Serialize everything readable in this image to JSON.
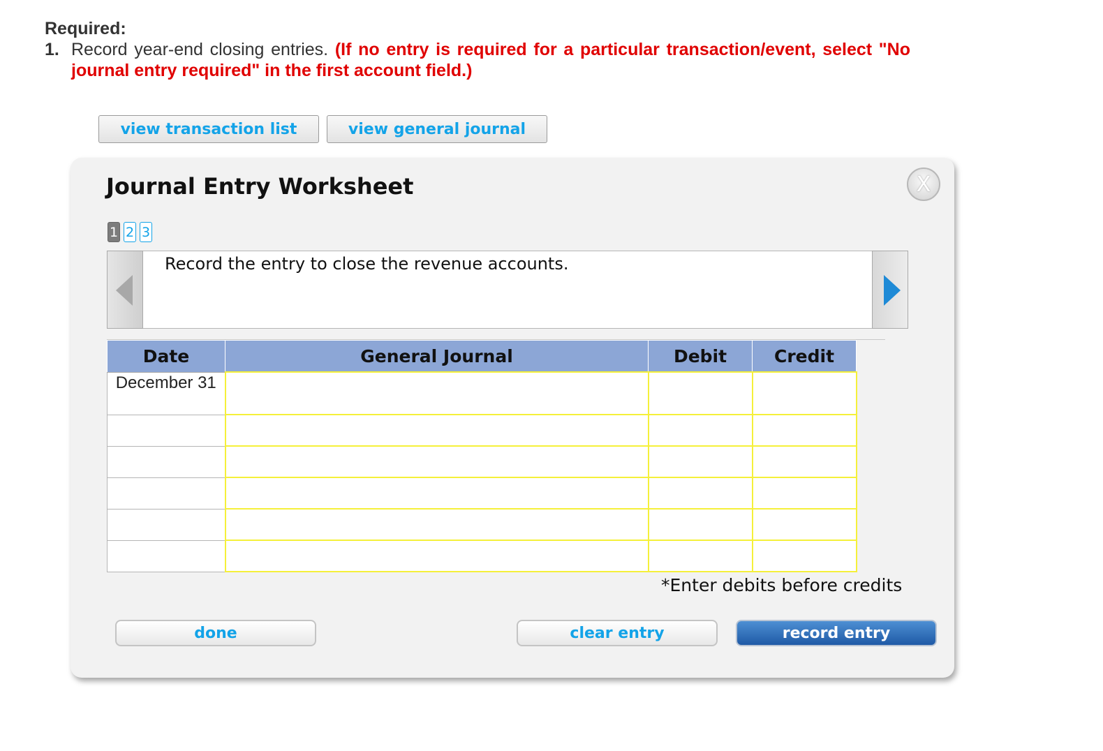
{
  "required": {
    "title": "Required:",
    "item_number": "1.",
    "item_text": "Record year-end closing entries.",
    "item_note": "(If no entry is required for a particular transaction/event, select \"No journal entry required\" in the first account field.)"
  },
  "top_buttons": {
    "transaction_list": "view transaction list",
    "general_journal": "view general journal"
  },
  "worksheet": {
    "title": "Journal Entry Worksheet",
    "close_label": "X",
    "steps": [
      "1",
      "2",
      "3"
    ],
    "active_step": 1,
    "instruction": "Record the entry to close the revenue accounts.",
    "columns": {
      "date": "Date",
      "general_journal": "General Journal",
      "debit": "Debit",
      "credit": "Credit"
    },
    "rows": [
      {
        "date": "December 31",
        "account": "",
        "debit": "",
        "credit": ""
      },
      {
        "date": "",
        "account": "",
        "debit": "",
        "credit": ""
      },
      {
        "date": "",
        "account": "",
        "debit": "",
        "credit": ""
      },
      {
        "date": "",
        "account": "",
        "debit": "",
        "credit": ""
      },
      {
        "date": "",
        "account": "",
        "debit": "",
        "credit": ""
      },
      {
        "date": "",
        "account": "",
        "debit": "",
        "credit": ""
      }
    ],
    "footnote": "*Enter debits before credits",
    "buttons": {
      "done": "done",
      "clear": "clear entry",
      "record": "record entry"
    }
  },
  "colors": {
    "link_blue": "#13a3e8",
    "note_red": "#e00000",
    "header_blue": "#8ca6d6",
    "input_outline": "#f5f03a",
    "primary_button": "#1f5aa6"
  }
}
